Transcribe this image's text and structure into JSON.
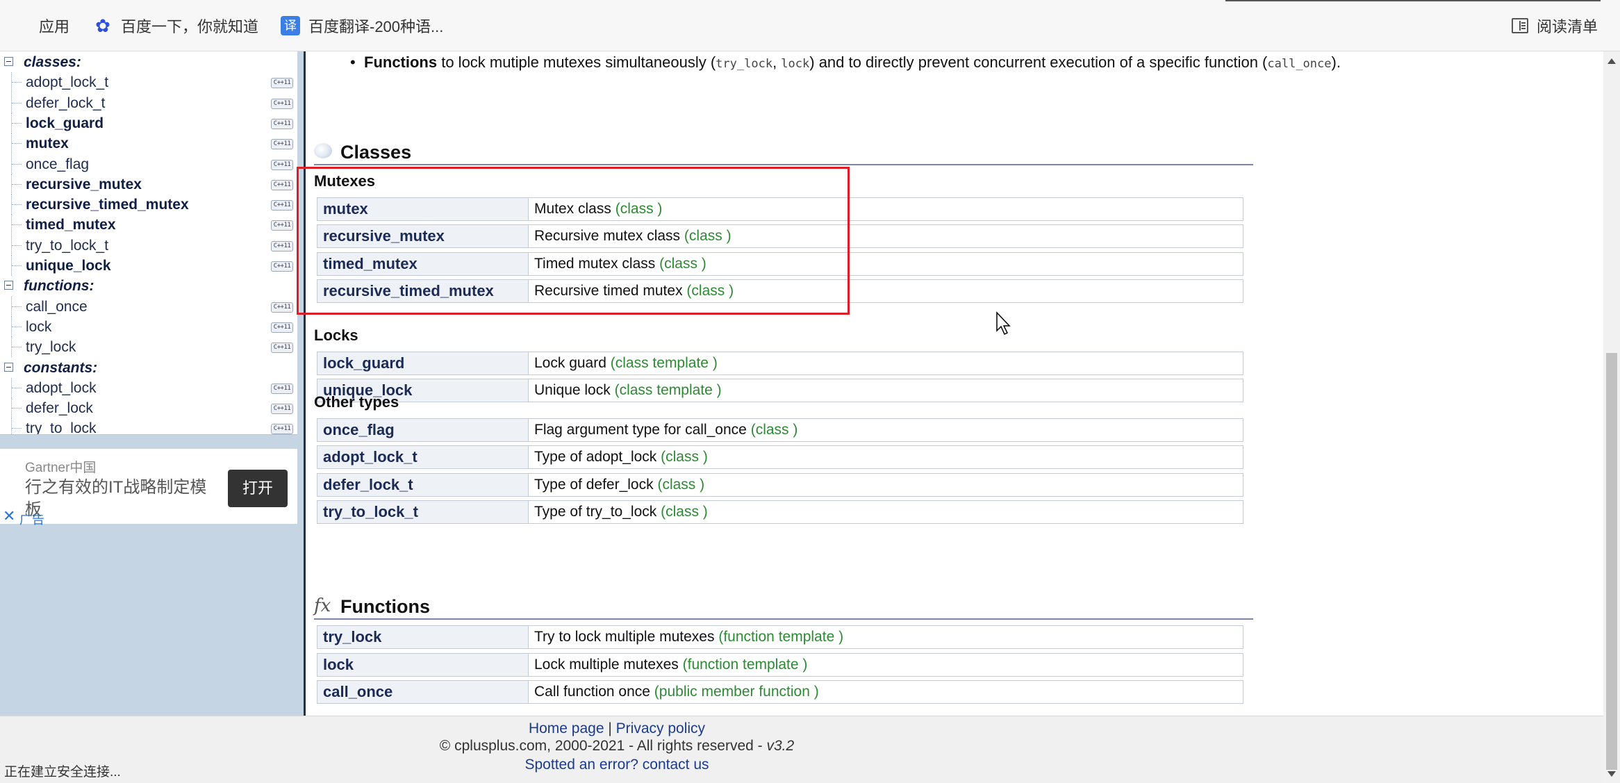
{
  "bookmarks": {
    "apps": "应用",
    "baidu": "百度一下，你就知道",
    "fanyi": "百度翻译-200种语...",
    "fanyi_icon_char": "译",
    "reader": "阅读清单"
  },
  "sidebar": {
    "groups": [
      {
        "label": "classes:",
        "items": [
          {
            "label": "adopt_lock_t",
            "bold": false
          },
          {
            "label": "defer_lock_t",
            "bold": false
          },
          {
            "label": "lock_guard",
            "bold": true
          },
          {
            "label": "mutex",
            "bold": true
          },
          {
            "label": "once_flag",
            "bold": false
          },
          {
            "label": "recursive_mutex",
            "bold": true
          },
          {
            "label": "recursive_timed_mutex",
            "bold": true
          },
          {
            "label": "timed_mutex",
            "bold": true
          },
          {
            "label": "try_to_lock_t",
            "bold": false
          },
          {
            "label": "unique_lock",
            "bold": true
          }
        ]
      },
      {
        "label": "functions:",
        "items": [
          {
            "label": "call_once",
            "bold": false
          },
          {
            "label": "lock",
            "bold": false
          },
          {
            "label": "try_lock",
            "bold": false
          }
        ]
      },
      {
        "label": "constants:",
        "items": [
          {
            "label": "adopt_lock",
            "bold": false
          },
          {
            "label": "defer_lock",
            "bold": false
          },
          {
            "label": "try_to_lock",
            "bold": false
          }
        ]
      }
    ],
    "cpp_badge": "C++11"
  },
  "ad": {
    "brand": "Gartner中国",
    "text": "行之有效的IT战略制定模板",
    "button": "打开",
    "close": "✕",
    "label": "广告"
  },
  "intro": {
    "bold": "Functions",
    "t1": " to lock mutiple mutexes simultaneously (",
    "c1": "try_lock",
    "t2": ", ",
    "c2": "lock",
    "t3": ") and to directly prevent concurrent execution of a specific function (",
    "c3": "call_once",
    "t4": ")."
  },
  "sections": {
    "classes_title": "Classes",
    "functions_title": "Functions",
    "fx_symbol": "fx"
  },
  "groups": [
    {
      "title": "Mutexes",
      "rows": [
        {
          "name": "mutex",
          "desc": "Mutex class",
          "kind": "class"
        },
        {
          "name": "recursive_mutex",
          "desc": "Recursive mutex class",
          "kind": "class"
        },
        {
          "name": "timed_mutex",
          "desc": "Timed mutex class",
          "kind": "class"
        },
        {
          "name": "recursive_timed_mutex",
          "desc": "Recursive timed mutex",
          "kind": "class"
        }
      ]
    },
    {
      "title": "Locks",
      "rows": [
        {
          "name": "lock_guard",
          "desc": "Lock guard",
          "kind": "class template"
        },
        {
          "name": "unique_lock",
          "desc": "Unique lock",
          "kind": "class template"
        }
      ]
    },
    {
      "title": "Other types",
      "rows": [
        {
          "name": "once_flag",
          "desc": "Flag argument type for call_once",
          "kind": "class"
        },
        {
          "name": "adopt_lock_t",
          "desc": "Type of adopt_lock",
          "kind": "class"
        },
        {
          "name": "defer_lock_t",
          "desc": "Type of defer_lock",
          "kind": "class"
        },
        {
          "name": "try_to_lock_t",
          "desc": "Type of try_to_lock",
          "kind": "class"
        }
      ]
    }
  ],
  "functions": [
    {
      "name": "try_lock",
      "desc": "Try to lock multiple mutexes",
      "kind": "function template"
    },
    {
      "name": "lock",
      "desc": "Lock multiple mutexes",
      "kind": "function template"
    },
    {
      "name": "call_once",
      "desc": "Call function once",
      "kind": "public member function"
    }
  ],
  "footer": {
    "home": "Home page",
    "sep": " | ",
    "privacy": "Privacy policy",
    "copyright": "© cplusplus.com, 2000-2021 - All rights reserved - ",
    "version": "v3.2",
    "spotted": "Spotted an error? contact us"
  },
  "status_text": "正在建立安全连接...",
  "colors": {
    "highlight_box": "#dc1f26",
    "kind_text": "#2c8a33",
    "link": "#1c3b8c",
    "sidebar_bg": "#c6d5e4"
  }
}
